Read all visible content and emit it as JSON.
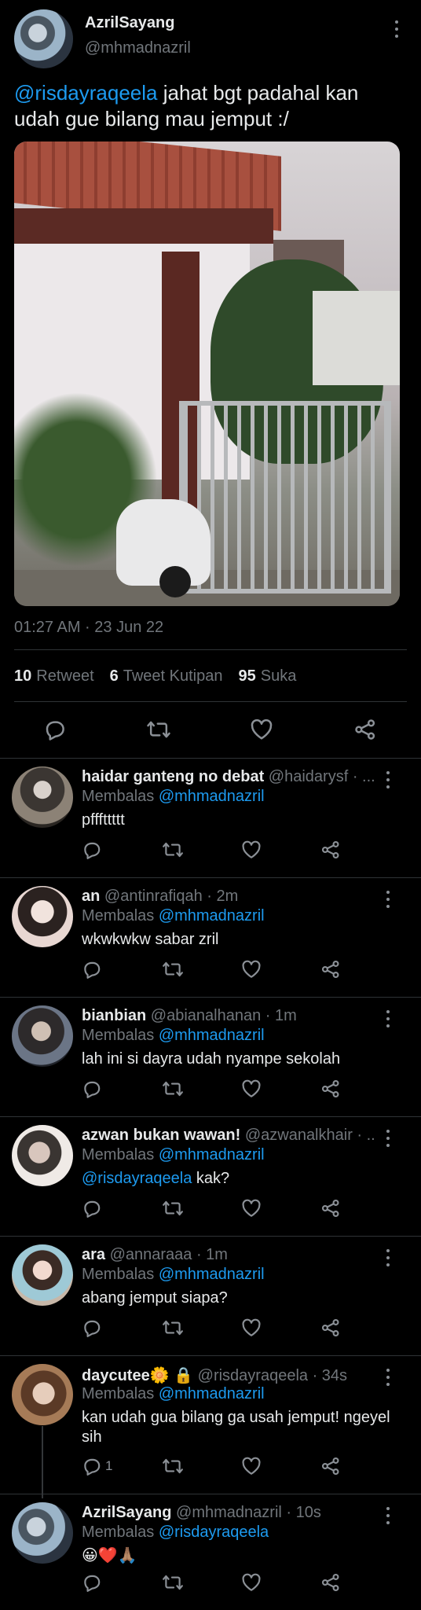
{
  "main_tweet": {
    "name": "AzrilSayang",
    "handle": "@mhmadnazril",
    "mention": "@risdayraqeela",
    "text": " jahat bgt padahal kan udah gue bilang mau jemput :/",
    "time": "01:27 AM · 23 Jun 22",
    "stats": [
      {
        "count": "10",
        "label": "Retweet"
      },
      {
        "count": "6",
        "label": "Tweet Kutipan"
      },
      {
        "count": "95",
        "label": "Suka"
      }
    ]
  },
  "replies": [
    {
      "name": "haidar ganteng no debat",
      "meta": " @haidarysf · ...",
      "replying_prefix": "Membalas ",
      "replying_to": "@mhmadnazril",
      "mention": "",
      "text": "pfffttttt",
      "reply_count": ""
    },
    {
      "name": "an",
      "meta": " @antinrafiqah · 2m",
      "replying_prefix": "Membalas ",
      "replying_to": "@mhmadnazril",
      "mention": "",
      "text": "wkwkwkw sabar zril",
      "reply_count": ""
    },
    {
      "name": "bianbian",
      "meta": " @abianalhanan · 1m",
      "replying_prefix": "Membalas ",
      "replying_to": "@mhmadnazril",
      "mention": "",
      "text": "lah ini si dayra udah nyampe sekolah",
      "reply_count": ""
    },
    {
      "name": "azwan bukan wawan!",
      "meta": " @azwanalkhair · ...",
      "replying_prefix": "Membalas ",
      "replying_to": "@mhmadnazril",
      "mention": "@risdayraqeela",
      "text": " kak?",
      "reply_count": ""
    },
    {
      "name": "ara",
      "meta": " @annaraaa · 1m",
      "replying_prefix": "Membalas ",
      "replying_to": "@mhmadnazril",
      "mention": "",
      "text": "abang jemput siapa?",
      "reply_count": ""
    },
    {
      "name": "daycutee🌼 🔒",
      "meta": " @risdayraqeela · 34s",
      "replying_prefix": "Membalas ",
      "replying_to": "@mhmadnazril",
      "mention": "",
      "text": "kan udah gua bilang ga usah jemput! ngeyel sih",
      "reply_count": "1"
    },
    {
      "name": "AzrilSayang",
      "meta": " @mhmadnazril · 10s",
      "replying_prefix": "Membalas ",
      "replying_to": "@risdayraqeela",
      "mention": "",
      "text": "😀❤️🙏🏽",
      "reply_count": ""
    }
  ],
  "icons": [
    "reply-icon",
    "retweet-icon",
    "like-icon",
    "share-icon",
    "more-icon"
  ],
  "colors": {
    "background": "#000000",
    "link": "#1d9bf0",
    "secondary": "#71767b",
    "divider": "#2f3336"
  }
}
